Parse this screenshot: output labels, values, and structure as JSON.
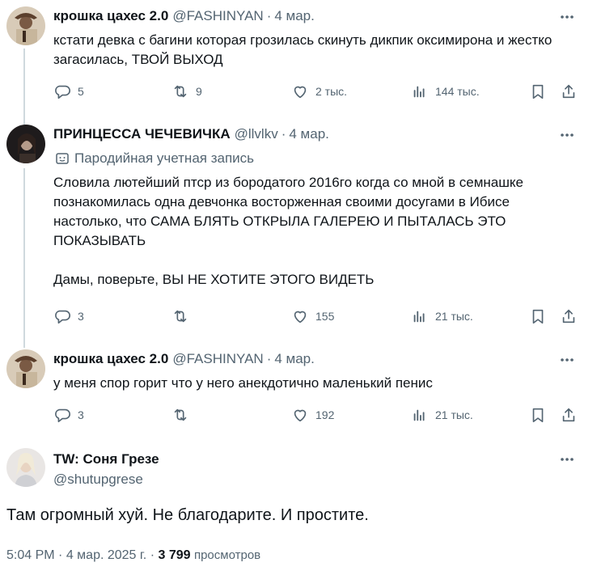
{
  "posts": [
    {
      "name": "крошка цахес 2.0",
      "handle": "@FASHINYAN",
      "date": "4 мар.",
      "text": [
        "кстати девка с багини которая грозилась скинуть дикпик оксимирона и жестко загасилась, ТВОЙ ВЫХОД"
      ],
      "replies": "5",
      "reposts": "9",
      "likes": "2 тыс.",
      "views": "144 тыс."
    },
    {
      "name": "ПРИНЦЕССА ЧЕЧЕВИЧКА",
      "handle": "@llvlkv",
      "date": "4 мар.",
      "parody_label": "Пародийная учетная запись",
      "text": [
        "Словила лютейший птср из бородатого 2016го когда со мной в семнашке познакомилась одна девчонка восторженная своими досугами в Ибисе настолько, что САМА БЛЯТЬ ОТКРЫЛА ГАЛЕРЕЮ И ПЫТАЛАСЬ ЭТО ПОКАЗЫВАТЬ",
        "Дамы, поверьте, ВЫ НЕ ХОТИТЕ ЭТОГО ВИДЕТЬ"
      ],
      "replies": "3",
      "reposts": "",
      "likes": "155",
      "views": "21 тыс."
    },
    {
      "name": "крошка цахес 2.0",
      "handle": "@FASHINYAN",
      "date": "4 мар.",
      "text": [
        "у меня спор горит что у него анекдотично маленький пенис"
      ],
      "replies": "3",
      "reposts": "",
      "likes": "192",
      "views": "21 тыс."
    }
  ],
  "main": {
    "name": "TW: Соня Грезе",
    "handle": "@shutupgrese",
    "text": "Там огромный хуй. Не благодарите. И простите.",
    "time": "5:04 PM",
    "date": "4 мар. 2025 г.",
    "views_count": "3 799",
    "views_label": "просмотров"
  },
  "dot": "·",
  "colors": {
    "text": "#0f1419",
    "muted": "#536471",
    "line": "#cfd9de"
  },
  "icons": [
    "more-icon",
    "reply-icon",
    "repost-icon",
    "like-icon",
    "views-icon",
    "bookmark-icon",
    "share-icon",
    "parody-icon"
  ]
}
